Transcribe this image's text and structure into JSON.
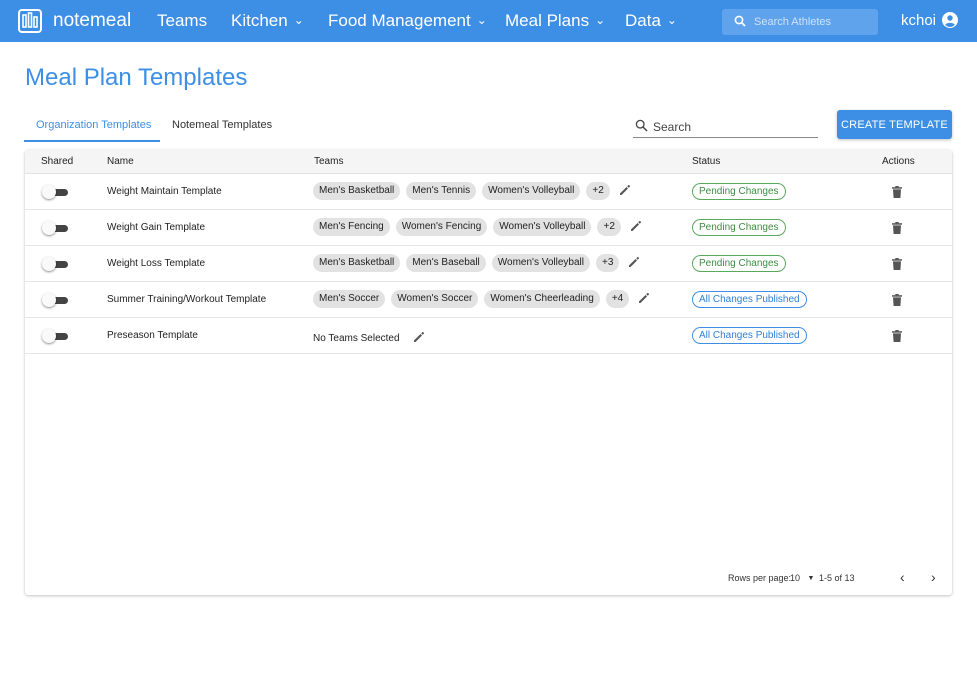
{
  "nav": {
    "brand": "notemeal",
    "items": [
      {
        "label": "Teams",
        "has_menu": false
      },
      {
        "label": "Kitchen",
        "has_menu": true
      },
      {
        "label": "Food Management",
        "has_menu": true
      },
      {
        "label": "Meal Plans",
        "has_menu": true
      },
      {
        "label": "Data",
        "has_menu": true
      }
    ],
    "search_placeholder": "Search Athletes",
    "username": "kchoi",
    "chevron": "⌄"
  },
  "page": {
    "title": "Meal Plan Templates",
    "tabs": [
      {
        "label": "Organization Templates",
        "active": true
      },
      {
        "label": "Notemeal Templates",
        "active": false
      }
    ],
    "search_placeholder": "Search",
    "create_label": "CREATE TEMPLATE"
  },
  "table": {
    "headers": {
      "shared": "Shared",
      "name": "Name",
      "teams": "Teams",
      "status": "Status",
      "actions": "Actions"
    },
    "rows": [
      {
        "shared": false,
        "name": "Weight Maintain Template",
        "teams": [
          "Men's Basketball",
          "Men's Tennis",
          "Women's Volleyball"
        ],
        "more": "+2",
        "status": "Pending Changes",
        "status_kind": "pending"
      },
      {
        "shared": false,
        "name": "Weight Gain Template",
        "teams": [
          "Men's Fencing",
          "Women's Fencing",
          "Women's Volleyball"
        ],
        "more": "+2",
        "status": "Pending Changes",
        "status_kind": "pending"
      },
      {
        "shared": false,
        "name": "Weight Loss Template",
        "teams": [
          "Men's Basketball",
          "Men's Baseball",
          "Women's Volleyball"
        ],
        "more": "+3",
        "status": "Pending Changes",
        "status_kind": "pending"
      },
      {
        "shared": false,
        "name": "Summer Training/Workout Template",
        "teams": [
          "Men's Soccer",
          "Women's Soccer",
          "Women's Cheerleading"
        ],
        "more": "+4",
        "status": "All Changes Published",
        "status_kind": "published"
      },
      {
        "shared": false,
        "name": "Preseason Template",
        "teams": [],
        "no_teams_label": "No Teams Selected",
        "more": "",
        "status": "All Changes Published",
        "status_kind": "published"
      }
    ]
  },
  "pagination": {
    "rows_per_page_label": "Rows per page:",
    "rows_per_page": "10",
    "dropdown_arrow": "▼",
    "range": "1-5 of 13",
    "prev": "‹",
    "next": "›"
  },
  "colors": {
    "brand": "#3d8fe6",
    "pending": "#3f8c43",
    "published": "#2f7fd6"
  },
  "icons": [
    "logo-icon",
    "search-icon",
    "user-circle-icon",
    "edit-icon",
    "trash-icon",
    "chevron-left-icon",
    "chevron-right-icon"
  ]
}
